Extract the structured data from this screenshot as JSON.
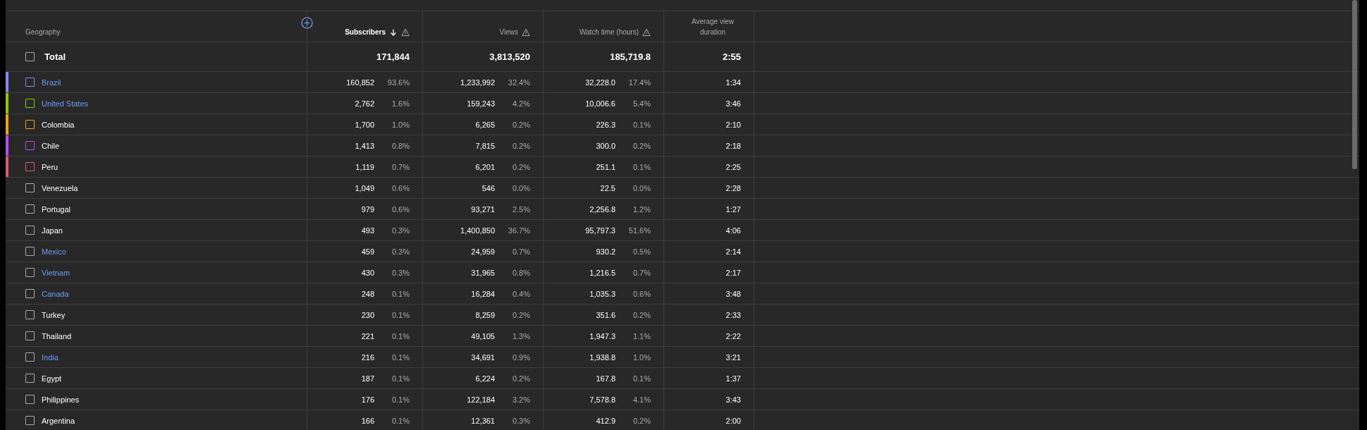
{
  "table": {
    "columns": [
      {
        "label": "Geography",
        "kind": "name",
        "sorted": false
      },
      {
        "label": "Subscribers",
        "kind": "metric",
        "sorted": true
      },
      {
        "label": "Views",
        "kind": "metric",
        "sorted": false
      },
      {
        "label": "Watch time (hours)",
        "kind": "metric",
        "sorted": false
      },
      {
        "label": "Average view duration",
        "kind": "plain",
        "sorted": false
      }
    ],
    "total": {
      "label": "Total",
      "checked": false,
      "subscribers": "171,844",
      "views": "3,813,520",
      "watch_time": "185,719.8",
      "avg_duration": "2:55"
    },
    "rows": [
      {
        "name": "Brazil",
        "kind": "link",
        "checked": false,
        "color": "#8b87f5",
        "subscribers": "160,852",
        "subscribers_pct": "93.6%",
        "views": "1,233,992",
        "views_pct": "32.4%",
        "watch_time": "32,228.0",
        "watch_time_pct": "17.4%",
        "avg_duration": "1:34"
      },
      {
        "name": "United States",
        "kind": "link",
        "checked": false,
        "color": "#8cc70d",
        "subscribers": "2,762",
        "subscribers_pct": "1.6%",
        "views": "159,243",
        "views_pct": "4.2%",
        "watch_time": "10,006.6",
        "watch_time_pct": "5.4%",
        "avg_duration": "3:46"
      },
      {
        "name": "Colombia",
        "kind": "plain",
        "checked": false,
        "color": "#e8a414",
        "subscribers": "1,700",
        "subscribers_pct": "1.0%",
        "views": "6,265",
        "views_pct": "0.2%",
        "watch_time": "226.3",
        "watch_time_pct": "0.1%",
        "avg_duration": "2:10"
      },
      {
        "name": "Chile",
        "kind": "plain",
        "checked": false,
        "color": "#b54cf2",
        "subscribers": "1,413",
        "subscribers_pct": "0.8%",
        "views": "7,815",
        "views_pct": "0.2%",
        "watch_time": "300.0",
        "watch_time_pct": "0.2%",
        "avg_duration": "2:18"
      },
      {
        "name": "Peru",
        "kind": "plain",
        "checked": false,
        "color": "#d45d73",
        "subscribers": "1,119",
        "subscribers_pct": "0.7%",
        "views": "6,201",
        "views_pct": "0.2%",
        "watch_time": "251.1",
        "watch_time_pct": "0.1%",
        "avg_duration": "2:25"
      },
      {
        "name": "Venezuela",
        "kind": "plain",
        "checked": false,
        "subscribers": "1,049",
        "subscribers_pct": "0.6%",
        "views": "546",
        "views_pct": "0.0%",
        "watch_time": "22.5",
        "watch_time_pct": "0.0%",
        "avg_duration": "2:28"
      },
      {
        "name": "Portugal",
        "kind": "plain",
        "checked": false,
        "subscribers": "979",
        "subscribers_pct": "0.6%",
        "views": "93,271",
        "views_pct": "2.5%",
        "watch_time": "2,256.8",
        "watch_time_pct": "1.2%",
        "avg_duration": "1:27"
      },
      {
        "name": "Japan",
        "kind": "plain",
        "checked": false,
        "subscribers": "493",
        "subscribers_pct": "0.3%",
        "views": "1,400,850",
        "views_pct": "36.7%",
        "watch_time": "95,797.3",
        "watch_time_pct": "51.6%",
        "avg_duration": "4:06"
      },
      {
        "name": "Mexico",
        "kind": "link",
        "checked": false,
        "subscribers": "459",
        "subscribers_pct": "0.3%",
        "views": "24,959",
        "views_pct": "0.7%",
        "watch_time": "930.2",
        "watch_time_pct": "0.5%",
        "avg_duration": "2:14"
      },
      {
        "name": "Vietnam",
        "kind": "link",
        "checked": false,
        "subscribers": "430",
        "subscribers_pct": "0.3%",
        "views": "31,965",
        "views_pct": "0.8%",
        "watch_time": "1,216.5",
        "watch_time_pct": "0.7%",
        "avg_duration": "2:17"
      },
      {
        "name": "Canada",
        "kind": "link",
        "checked": false,
        "subscribers": "248",
        "subscribers_pct": "0.1%",
        "views": "16,284",
        "views_pct": "0.4%",
        "watch_time": "1,035.3",
        "watch_time_pct": "0.6%",
        "avg_duration": "3:48"
      },
      {
        "name": "Turkey",
        "kind": "plain",
        "checked": false,
        "subscribers": "230",
        "subscribers_pct": "0.1%",
        "views": "8,259",
        "views_pct": "0.2%",
        "watch_time": "351.6",
        "watch_time_pct": "0.2%",
        "avg_duration": "2:33"
      },
      {
        "name": "Thailand",
        "kind": "plain",
        "checked": false,
        "subscribers": "221",
        "subscribers_pct": "0.1%",
        "views": "49,105",
        "views_pct": "1.3%",
        "watch_time": "1,947.3",
        "watch_time_pct": "1.1%",
        "avg_duration": "2:22"
      },
      {
        "name": "India",
        "kind": "link",
        "checked": false,
        "subscribers": "216",
        "subscribers_pct": "0.1%",
        "views": "34,691",
        "views_pct": "0.9%",
        "watch_time": "1,938.8",
        "watch_time_pct": "1.0%",
        "avg_duration": "3:21"
      },
      {
        "name": "Egypt",
        "kind": "plain",
        "checked": false,
        "subscribers": "187",
        "subscribers_pct": "0.1%",
        "views": "6,224",
        "views_pct": "0.2%",
        "watch_time": "167.8",
        "watch_time_pct": "0.1%",
        "avg_duration": "1:37"
      },
      {
        "name": "Philippines",
        "kind": "plain",
        "checked": false,
        "subscribers": "176",
        "subscribers_pct": "0.1%",
        "views": "122,184",
        "views_pct": "3.2%",
        "watch_time": "7,578.8",
        "watch_time_pct": "4.1%",
        "avg_duration": "3:43"
      },
      {
        "name": "Argentina",
        "kind": "plain",
        "checked": false,
        "subscribers": "166",
        "subscribers_pct": "0.1%",
        "views": "12,361",
        "views_pct": "0.3%",
        "watch_time": "412.9",
        "watch_time_pct": "0.2%",
        "avg_duration": "2:00"
      }
    ]
  }
}
